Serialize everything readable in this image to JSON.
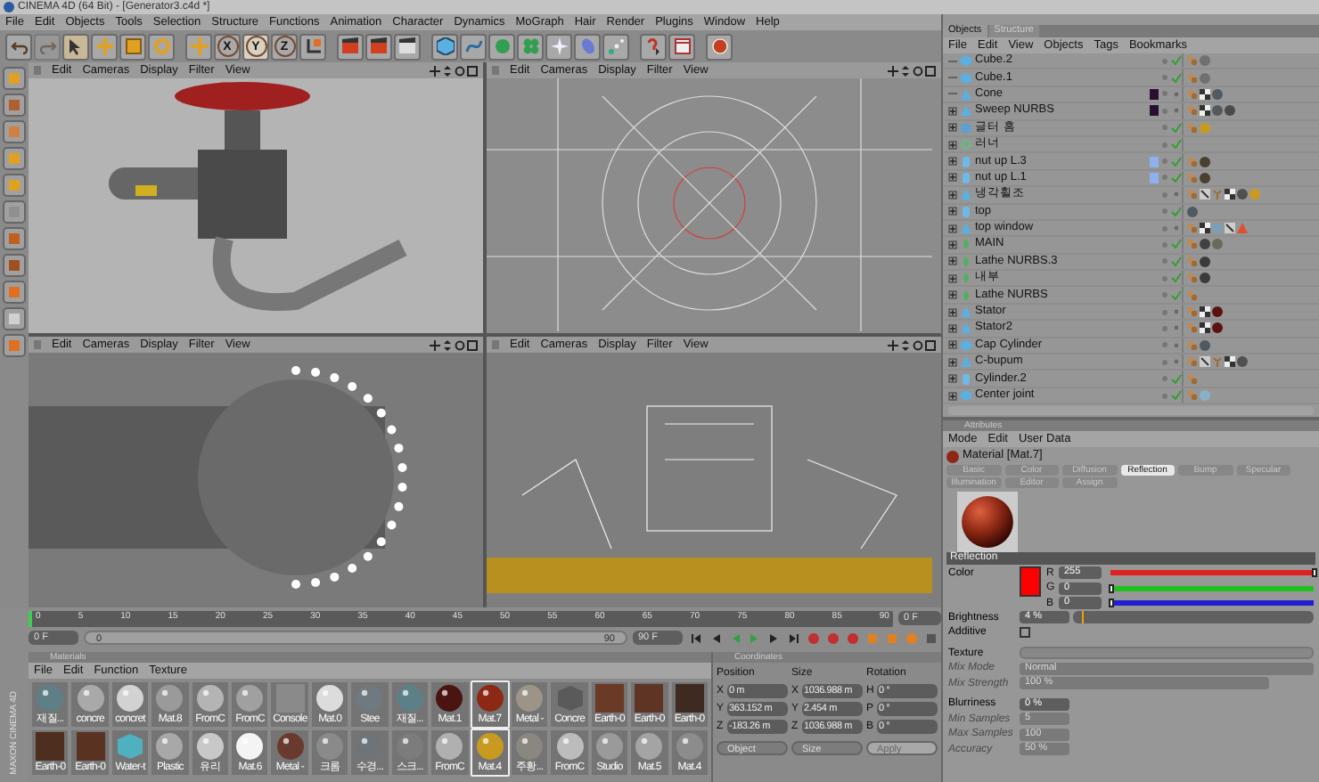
{
  "window": {
    "title": "CINEMA 4D (64 Bit) - [Generator3.c4d *]"
  },
  "menu": [
    "File",
    "Edit",
    "Objects",
    "Tools",
    "Selection",
    "Structure",
    "Functions",
    "Animation",
    "Character",
    "Dynamics",
    "MoGraph",
    "Hair",
    "Render",
    "Plugins",
    "Window",
    "Help"
  ],
  "toolbar": [
    {
      "kind": "undo",
      "disabled": false
    },
    {
      "kind": "redo",
      "disabled": true
    },
    {
      "kind": "select",
      "selected": true
    },
    {
      "kind": "move",
      "selected": false
    },
    {
      "kind": "scale",
      "selected": false
    },
    {
      "kind": "rotate",
      "selected": false
    },
    {
      "kind": "sep"
    },
    {
      "kind": "axes",
      "selected": false
    },
    {
      "kind": "axis",
      "label": "X",
      "selected": false
    },
    {
      "kind": "axis",
      "label": "Y",
      "selected": true
    },
    {
      "kind": "axis",
      "label": "Z",
      "selected": false
    },
    {
      "kind": "coords",
      "selected": false
    },
    {
      "kind": "sep"
    },
    {
      "kind": "render_view",
      "selected": false
    },
    {
      "kind": "render",
      "selected": false
    },
    {
      "kind": "render_settings",
      "selected": false
    },
    {
      "kind": "sep"
    },
    {
      "kind": "cube",
      "selected": false
    },
    {
      "kind": "spline",
      "selected": false
    },
    {
      "kind": "nurbs",
      "selected": false
    },
    {
      "kind": "array",
      "selected": false
    },
    {
      "kind": "deformer",
      "selected": false
    },
    {
      "kind": "scene",
      "selected": false
    },
    {
      "kind": "particle",
      "selected": false
    },
    {
      "kind": "sep"
    },
    {
      "kind": "help",
      "selected": false
    },
    {
      "kind": "timeline",
      "selected": false
    },
    {
      "kind": "sep"
    },
    {
      "kind": "web",
      "selected": false
    }
  ],
  "viewports": [
    {
      "menu": [
        "Edit",
        "Cameras",
        "Display",
        "Filter",
        "View"
      ],
      "kind": "perspective_shaded"
    },
    {
      "menu": [
        "Edit",
        "Cameras",
        "Display",
        "Filter",
        "View"
      ],
      "kind": "perspective_wire"
    },
    {
      "menu": [
        "Edit",
        "Cameras",
        "Display",
        "Filter",
        "View"
      ],
      "kind": "top"
    },
    {
      "menu": [
        "Edit",
        "Cameras",
        "Display",
        "Filter",
        "View"
      ],
      "kind": "front"
    }
  ],
  "timeline": {
    "ruler": [
      "0",
      "5",
      "10",
      "15",
      "20",
      "25",
      "30",
      "35",
      "40",
      "45",
      "50",
      "55",
      "60",
      "65",
      "70",
      "75",
      "80",
      "85",
      "90"
    ],
    "current_field": "0 F",
    "start_field": "0 F",
    "range_start": "0",
    "range_end": "90",
    "end_field": "90 F"
  },
  "materials": {
    "title": "Materials",
    "menu": [
      "File",
      "Edit",
      "Function",
      "Texture"
    ],
    "logo": "MAXON CINEMA 4D",
    "items": [
      {
        "name": "재질...",
        "kind": "sphere",
        "color": "#5f7f86",
        "selected": false
      },
      {
        "name": "concre",
        "kind": "sphere",
        "color": "#a9a9a9",
        "selected": false
      },
      {
        "name": "concret",
        "kind": "sphere",
        "color": "#d2d2d2",
        "selected": false
      },
      {
        "name": "Mat.8",
        "kind": "sphere",
        "color": "#9a9a9a",
        "selected": false
      },
      {
        "name": "FromC",
        "kind": "sphere",
        "color": "#b4b4b4",
        "selected": false
      },
      {
        "name": "FromC",
        "kind": "sphere",
        "color": "#a0a0a0",
        "selected": false
      },
      {
        "name": "Console",
        "kind": "tile",
        "color": "#8a8a8a",
        "selected": false
      },
      {
        "name": "Mat.0",
        "kind": "sphere",
        "color": "#dcdcdc",
        "selected": false
      },
      {
        "name": "Stee",
        "kind": "sphere",
        "color": "#6f7a80",
        "selected": false
      },
      {
        "name": "재질...",
        "kind": "sphere",
        "color": "#5d8088",
        "selected": false
      },
      {
        "name": "Mat.1",
        "kind": "sphere",
        "color": "#4a1410",
        "selected": false
      },
      {
        "name": "Mat.7",
        "kind": "sphere",
        "color": "#8c2814",
        "selected": true
      },
      {
        "name": "Metal -",
        "kind": "sphere",
        "color": "#9c9486",
        "selected": false
      },
      {
        "name": "Concre",
        "kind": "cube",
        "color": "#5a5a5a",
        "selected": false
      },
      {
        "name": "Earth-0",
        "kind": "tile",
        "color": "#6a3a26",
        "selected": false
      },
      {
        "name": "Earth-0",
        "kind": "tile",
        "color": "#5e3424",
        "selected": false
      },
      {
        "name": "Earth-0",
        "kind": "tile",
        "color": "#3e2a20",
        "selected": false
      },
      {
        "name": "Earth-0",
        "kind": "tile",
        "color": "#4e2e1e",
        "selected": false
      },
      {
        "name": "Earth-0",
        "kind": "tile",
        "color": "#5a3222",
        "selected": false
      },
      {
        "name": "Water-t",
        "kind": "cube",
        "color": "#4fb0c0",
        "selected": false
      },
      {
        "name": "Plastic",
        "kind": "sphere",
        "color": "#a8a8a8",
        "selected": false
      },
      {
        "name": "유리",
        "kind": "sphere",
        "color": "#c8c8c8",
        "selected": false
      },
      {
        "name": "Mat.6",
        "kind": "sphere",
        "color": "#f4f4f4",
        "selected": false
      },
      {
        "name": "Metal -",
        "kind": "sphere",
        "color": "#6a3a2e",
        "selected": false
      },
      {
        "name": "크롬",
        "kind": "sphere",
        "color": "#8a8a8a",
        "selected": false
      },
      {
        "name": "수경...",
        "kind": "sphere",
        "color": "#6e7478",
        "selected": false
      },
      {
        "name": "스크...",
        "kind": "sphere",
        "color": "#7c7c7c",
        "selected": false
      },
      {
        "name": "FromC",
        "kind": "sphere",
        "color": "#b0b0b0",
        "selected": false
      },
      {
        "name": "Mat.4",
        "kind": "sphere",
        "color": "#c89a20",
        "selected": true
      },
      {
        "name": "주황...",
        "kind": "sphere",
        "color": "#8a8680",
        "selected": false
      },
      {
        "name": "FromC",
        "kind": "sphere",
        "color": "#bcbcbc",
        "selected": false
      },
      {
        "name": "Studio",
        "kind": "sphere",
        "color": "#9a9a9a",
        "selected": false
      },
      {
        "name": "Mat.5",
        "kind": "sphere",
        "color": "#a4a4a4",
        "selected": false
      },
      {
        "name": "Mat.4",
        "kind": "sphere",
        "color": "#8c8c8c",
        "selected": false
      }
    ]
  },
  "coordinates": {
    "title": "Coordinates",
    "columns": [
      {
        "heading": "Position",
        "fields": [
          {
            "axis": "X",
            "value": "0 m"
          },
          {
            "axis": "Y",
            "value": "363.152 m"
          },
          {
            "axis": "Z",
            "value": "-183.26 m"
          }
        ],
        "kind": "dropdown",
        "control": "Object"
      },
      {
        "heading": "Size",
        "fields": [
          {
            "axis": "X",
            "value": "1036.988 m"
          },
          {
            "axis": "Y",
            "value": "2.454 m"
          },
          {
            "axis": "Z",
            "value": "1036.988 m"
          }
        ],
        "kind": "dropdown",
        "control": "Size"
      },
      {
        "heading": "Rotation",
        "fields": [
          {
            "axis": "H",
            "value": "0 °"
          },
          {
            "axis": "P",
            "value": "0 °"
          },
          {
            "axis": "B",
            "value": "0 °"
          }
        ],
        "kind": "button",
        "control": "Apply"
      }
    ]
  },
  "objects": {
    "tabs": [
      {
        "label": "Objects",
        "selected": true
      },
      {
        "label": "Structure",
        "selected": false
      }
    ],
    "menu": [
      "File",
      "Edit",
      "View",
      "Objects",
      "Tags",
      "Bookmarks"
    ],
    "rows": [
      {
        "name": "Cube.2",
        "kind": "cube",
        "expandable": false,
        "enabled": true,
        "tags": [
          {
            "kind": "phong"
          },
          {
            "kind": "material",
            "color": "#707070"
          }
        ]
      },
      {
        "name": "Cube.1",
        "kind": "cube",
        "expandable": false,
        "enabled": true,
        "tags": [
          {
            "kind": "phong"
          },
          {
            "kind": "material",
            "color": "#707070"
          }
        ]
      },
      {
        "name": "Cone",
        "kind": "cone",
        "expandable": false,
        "enabled": false,
        "color": "#2a1030",
        "tags": [
          {
            "kind": "phong"
          },
          {
            "kind": "uvw"
          },
          {
            "kind": "material",
            "color": "#505a60"
          }
        ]
      },
      {
        "name": "Sweep NURBS",
        "kind": "cone",
        "expandable": true,
        "enabled": false,
        "color": "#2a1030",
        "tags": [
          {
            "kind": "phong"
          },
          {
            "kind": "uvw"
          },
          {
            "kind": "material",
            "color": "#505a60"
          },
          {
            "kind": "material",
            "color": "#4a4a4a"
          }
        ]
      },
      {
        "name": "글터 홈",
        "kind": "array",
        "expandable": true,
        "enabled": true,
        "tags": [
          {
            "kind": "phong"
          },
          {
            "kind": "material",
            "color": "#c89a20"
          }
        ]
      },
      {
        "name": "러너",
        "kind": "null",
        "expandable": true,
        "enabled": true,
        "tags": []
      },
      {
        "name": "nut up L.3",
        "kind": "cylinder",
        "expandable": true,
        "enabled": true,
        "color": "#8fb0f0",
        "tags": [
          {
            "kind": "phong"
          },
          {
            "kind": "material",
            "color": "#4a4030"
          }
        ]
      },
      {
        "name": "nut up L.1",
        "kind": "cylinder",
        "expandable": true,
        "enabled": true,
        "color": "#8fb0f0",
        "tags": [
          {
            "kind": "phong"
          },
          {
            "kind": "material",
            "color": "#4a4030"
          }
        ]
      },
      {
        "name": "냉각휠조",
        "kind": "cone",
        "expandable": true,
        "enabled": false,
        "tags": [
          {
            "kind": "phong"
          },
          {
            "kind": "selection"
          },
          {
            "kind": "psi"
          },
          {
            "kind": "uvw"
          },
          {
            "kind": "material",
            "color": "#505050"
          },
          {
            "kind": "material",
            "color": "#c89a20"
          }
        ]
      },
      {
        "name": "top",
        "kind": "cylinder",
        "expandable": true,
        "enabled": true,
        "tags": [
          {
            "kind": "material",
            "color": "#505a60"
          }
        ]
      },
      {
        "name": "top window",
        "kind": "cone",
        "expandable": true,
        "enabled": false,
        "tags": [
          {
            "kind": "phong"
          },
          {
            "kind": "uvw"
          },
          {
            "kind": "material",
            "color": "#7aa0b8"
          },
          {
            "kind": "selection"
          },
          {
            "kind": "warning"
          }
        ]
      },
      {
        "name": "MAIN",
        "kind": "lathe",
        "expandable": true,
        "enabled": true,
        "tags": [
          {
            "kind": "phong"
          },
          {
            "kind": "material",
            "color": "#404040"
          },
          {
            "kind": "material",
            "color": "#6a6a5a"
          }
        ]
      },
      {
        "name": "Lathe NURBS.3",
        "kind": "lathe",
        "expandable": true,
        "enabled": true,
        "tags": [
          {
            "kind": "phong"
          },
          {
            "kind": "material",
            "color": "#3a3a3a"
          }
        ]
      },
      {
        "name": "내부",
        "kind": "lathe",
        "expandable": true,
        "enabled": true,
        "tags": [
          {
            "kind": "phong"
          },
          {
            "kind": "material",
            "color": "#3a3a3a"
          }
        ]
      },
      {
        "name": "Lathe NURBS",
        "kind": "lathe",
        "expandable": true,
        "enabled": true,
        "tags": [
          {
            "kind": "phong"
          }
        ]
      },
      {
        "name": "Stator",
        "kind": "cone",
        "expandable": true,
        "enabled": false,
        "tags": [
          {
            "kind": "phong"
          },
          {
            "kind": "uvw"
          },
          {
            "kind": "material",
            "color": "#5a1410"
          }
        ]
      },
      {
        "name": "Stator2",
        "kind": "cone",
        "expandable": true,
        "enabled": false,
        "tags": [
          {
            "kind": "phong"
          },
          {
            "kind": "uvw"
          },
          {
            "kind": "material",
            "color": "#5a1410"
          }
        ]
      },
      {
        "name": "Cap Cylinder",
        "kind": "cube",
        "expandable": true,
        "enabled": false,
        "tags": [
          {
            "kind": "phong"
          },
          {
            "kind": "material",
            "color": "#505a60"
          }
        ]
      },
      {
        "name": "C-bupum",
        "kind": "cone",
        "expandable": true,
        "enabled": false,
        "tags": [
          {
            "kind": "phong"
          },
          {
            "kind": "selection"
          },
          {
            "kind": "psi"
          },
          {
            "kind": "uvw"
          },
          {
            "kind": "material",
            "color": "#505050"
          }
        ]
      },
      {
        "name": "Cylinder.2",
        "kind": "cylinder",
        "expandable": true,
        "enabled": true,
        "tags": [
          {
            "kind": "phong"
          }
        ]
      },
      {
        "name": "Center joint",
        "kind": "cube",
        "expandable": true,
        "enabled": true,
        "tags": [
          {
            "kind": "phong"
          },
          {
            "kind": "material",
            "color": "#8ab0c8"
          }
        ]
      }
    ]
  },
  "attributes": {
    "title": "Attributes",
    "menu": [
      "Mode",
      "Edit",
      "User Data"
    ],
    "material": "Material [Mat.7]",
    "tabs": [
      {
        "label": "Basic",
        "selected": false
      },
      {
        "label": "Color",
        "selected": false
      },
      {
        "label": "Diffusion",
        "selected": false
      },
      {
        "label": "Reflection",
        "selected": true
      },
      {
        "label": "Bump",
        "selected": false
      },
      {
        "label": "Specular",
        "selected": false
      },
      {
        "label": "Illumination",
        "selected": false
      },
      {
        "label": "Editor",
        "selected": false
      },
      {
        "label": "Assign",
        "selected": false
      }
    ],
    "section": "Reflection",
    "groups": [
      [
        {
          "kind": "color",
          "label": "Color",
          "color": "#ff0000",
          "disabled": false,
          "channels": [
            {
              "label": "R",
              "value": "255",
              "level": 1,
              "color": "#e02020"
            },
            {
              "label": "G",
              "value": "0",
              "level": 0,
              "color": "#20c020"
            },
            {
              "label": "B",
              "value": "0",
              "level": 0,
              "color": "#2020d0"
            }
          ]
        },
        {
          "kind": "slider",
          "label": "Brightness",
          "value": "4 %",
          "level": 0.04,
          "disabled": false
        },
        {
          "kind": "checkbox",
          "label": "Additive",
          "checked": false,
          "disabled": false
        }
      ],
      [
        {
          "kind": "texture",
          "label": "Texture",
          "disabled": false
        },
        {
          "kind": "dropdown",
          "label": "Mix Mode",
          "value": "Normal",
          "disabled": true
        },
        {
          "kind": "wide_field",
          "label": "Mix Strength",
          "value": "100 %",
          "disabled": true
        }
      ],
      [
        {
          "kind": "field",
          "label": "Blurriness",
          "value": "0 %",
          "disabled": false
        },
        {
          "kind": "field",
          "label": "Min Samples",
          "value": "5",
          "disabled": true
        },
        {
          "kind": "field",
          "label": "Max Samples",
          "value": "100",
          "disabled": true
        },
        {
          "kind": "field",
          "label": "Accuracy",
          "value": "50 %",
          "disabled": true
        }
      ]
    ]
  }
}
